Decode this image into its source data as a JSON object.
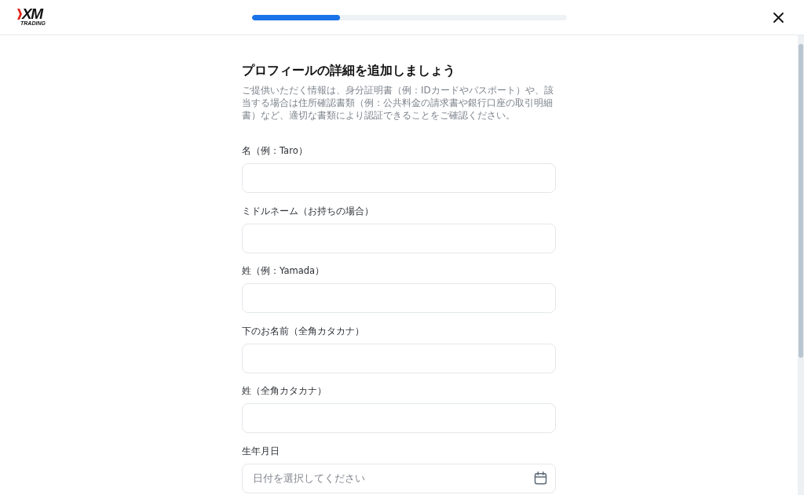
{
  "header": {
    "logo": {
      "wordmark": "XM",
      "tagline": "TRADING"
    },
    "progress": {
      "level": 0.28
    }
  },
  "title": "プロフィールの詳細を追加しましょう",
  "description": "ご提供いただく情報は、身分証明書（例：IDカードやパスポート）や、該当する場合は住所確認書類（例：公共料金の請求書や銀行口座の取引明細書）など、適切な書類により認証できることをご確認ください。",
  "fields": [
    {
      "label": "名（例：Taro）",
      "kind": "text"
    },
    {
      "label": "ミドルネーム（お持ちの場合）",
      "kind": "text"
    },
    {
      "label": "姓（例：Yamada）",
      "kind": "text"
    },
    {
      "label": "下のお名前（全角カタカナ）",
      "kind": "text"
    },
    {
      "label": "姓（全角カタカナ）",
      "kind": "text"
    },
    {
      "label": "生年月日",
      "kind": "date",
      "placeholder": "日付を選択してください"
    }
  ]
}
